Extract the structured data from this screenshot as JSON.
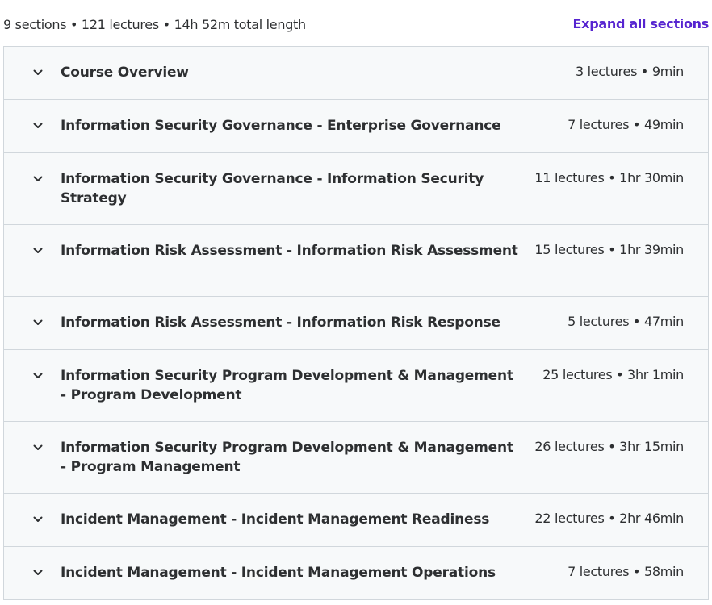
{
  "summary": {
    "text": "9 sections • 121 lectures • 14h 52m total length",
    "expand_label": "Expand all sections"
  },
  "icons": {
    "chevron": "chevron-down-icon"
  },
  "colors": {
    "link": "#5624d0",
    "section_bg": "#f7f9fa",
    "border": "#d1d7dc",
    "text": "#2d2f31"
  },
  "sections": [
    {
      "title": "Course Overview",
      "meta": "3 lectures • 9min"
    },
    {
      "title": "Information Security Governance - Enterprise Governance",
      "meta": "7 lectures • 49min"
    },
    {
      "title": "Information Security Governance - Information Security Strategy",
      "meta": "11 lectures • 1hr 30min"
    },
    {
      "title": "Information Risk Assessment - Information Risk Assessment",
      "meta": "15 lectures • 1hr 39min"
    },
    {
      "title": "Information Risk Assessment - Information Risk Response",
      "meta": "5 lectures • 47min"
    },
    {
      "title": "Information Security Program Development & Management - Program Development",
      "meta": "25 lectures • 3hr 1min"
    },
    {
      "title": "Information Security Program Development & Management - Program Management",
      "meta": "26 lectures • 3hr 15min"
    },
    {
      "title": "Incident Management - Incident Management Readiness",
      "meta": "22 lectures • 2hr 46min"
    },
    {
      "title": "Incident Management - Incident Management Operations",
      "meta": "7 lectures • 58min"
    }
  ]
}
